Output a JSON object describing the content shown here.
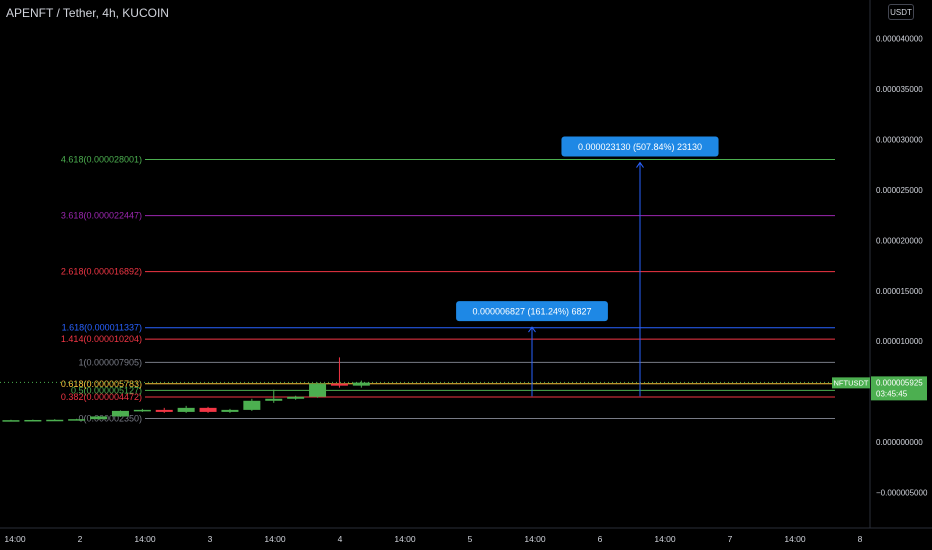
{
  "header": {
    "title": "APENFT / Tether, 4h, KUCOIN",
    "currency_button": "USDT"
  },
  "price_tag": {
    "symbol": "NFTUSDT",
    "price": "0.000005925",
    "countdown": "03:45:45"
  },
  "colors": {
    "up": "#4caf50",
    "down": "#f23645",
    "axis_text": "#d1d4dc",
    "badge": "#1e88e5"
  },
  "chart_data": {
    "type": "candlestick",
    "title": "APENFT / Tether, 4h, KUCOIN",
    "y_axis": {
      "ticks": [
        4e-05,
        3.5e-05,
        3e-05,
        2.5e-05,
        2e-05,
        1.5e-05,
        1e-05,
        5e-06,
        0,
        -5e-06
      ],
      "tick_labels": [
        "0.000040000",
        "0.000035000",
        "0.000030000",
        "0.000025000",
        "0.000020000",
        "0.000015000",
        "0.000010000",
        "0.000005000",
        "0.000000000",
        "−0.000005000"
      ],
      "range": [
        -8.5e-06,
        4.38e-05
      ]
    },
    "x_axis": {
      "tick_labels": [
        "14:00",
        "2",
        "14:00",
        "3",
        "14:00",
        "4",
        "14:00",
        "5",
        "14:00",
        "6",
        "14:00",
        "7",
        "14:00",
        "8"
      ]
    },
    "candles": [
      {
        "o": 2.15e-06,
        "h": 2.22e-06,
        "l": 2.09e-06,
        "c": 2.18e-06
      },
      {
        "o": 2.18e-06,
        "h": 2.24e-06,
        "l": 2.12e-06,
        "c": 2.2e-06
      },
      {
        "o": 2.2e-06,
        "h": 2.28e-06,
        "l": 2.14e-06,
        "c": 2.22e-06
      },
      {
        "o": 2.22e-06,
        "h": 2.32e-06,
        "l": 2.18e-06,
        "c": 2.28e-06
      },
      {
        "o": 2.28e-06,
        "h": 2.6e-06,
        "l": 2.24e-06,
        "c": 2.55e-06
      },
      {
        "o": 2.55e-06,
        "h": 3.15e-06,
        "l": 2.5e-06,
        "c": 3.1e-06
      },
      {
        "o": 3.1e-06,
        "h": 3.3e-06,
        "l": 3e-06,
        "c": 3.2e-06
      },
      {
        "o": 3.2e-06,
        "h": 3.4e-06,
        "l": 2.9e-06,
        "c": 3e-06
      },
      {
        "o": 3e-06,
        "h": 3.6e-06,
        "l": 2.9e-06,
        "c": 3.4e-06
      },
      {
        "o": 3.4e-06,
        "h": 3.5e-06,
        "l": 2.9e-06,
        "c": 3e-06
      },
      {
        "o": 3e-06,
        "h": 3.3e-06,
        "l": 2.9e-06,
        "c": 3.2e-06
      },
      {
        "o": 3.2e-06,
        "h": 4.3e-06,
        "l": 3.1e-06,
        "c": 4.1e-06
      },
      {
        "o": 4.1e-06,
        "h": 5.2e-06,
        "l": 3.9e-06,
        "c": 4.3e-06
      },
      {
        "o": 4.3e-06,
        "h": 4.6e-06,
        "l": 4.2e-06,
        "c": 4.5e-06
      },
      {
        "o": 4.5e-06,
        "h": 5.9e-06,
        "l": 4.4e-06,
        "c": 5.8e-06
      },
      {
        "o": 5.8e-06,
        "h": 8.4e-06,
        "l": 5.4e-06,
        "c": 5.6e-06
      },
      {
        "o": 5.6e-06,
        "h": 6.1e-06,
        "l": 5.4e-06,
        "c": 5.9e-06
      }
    ],
    "last_price": 5.925e-06,
    "fib_levels": [
      {
        "label": "0(0.000002350)",
        "value": 2.35e-06,
        "color": "#787b86"
      },
      {
        "label": "0.382(0.000004472)",
        "value": 4.472e-06,
        "color": "#f23645"
      },
      {
        "label": "0.5(0.000005127)",
        "value": 5.127e-06,
        "color": "#4caf50"
      },
      {
        "label": "0.618(0.000005783)",
        "value": 5.783e-06,
        "color": "#f7c23c"
      },
      {
        "label": "1(0.000007905)",
        "value": 7.905e-06,
        "color": "#787b86"
      },
      {
        "label": "1.414(0.000010204)",
        "value": 1.0204e-05,
        "color": "#f23645"
      },
      {
        "label": "1.618(0.000011337)",
        "value": 1.1337e-05,
        "color": "#2962ff"
      },
      {
        "label": "2.618(0.000016892)",
        "value": 1.6892e-05,
        "color": "#f23645"
      },
      {
        "label": "3.618(0.000022447)",
        "value": 2.2447e-05,
        "color": "#9c27b0"
      },
      {
        "label": "4.618(0.000028001)",
        "value": 2.8001e-05,
        "color": "#4caf50"
      }
    ],
    "measurements": [
      {
        "text": "0.000006827 (161.24%) 6827",
        "from": 4.55e-06,
        "to": 1.14e-05
      },
      {
        "text": "0.000023130 (507.84%) 23130",
        "from": 4.55e-06,
        "to": 2.77e-05
      }
    ]
  }
}
